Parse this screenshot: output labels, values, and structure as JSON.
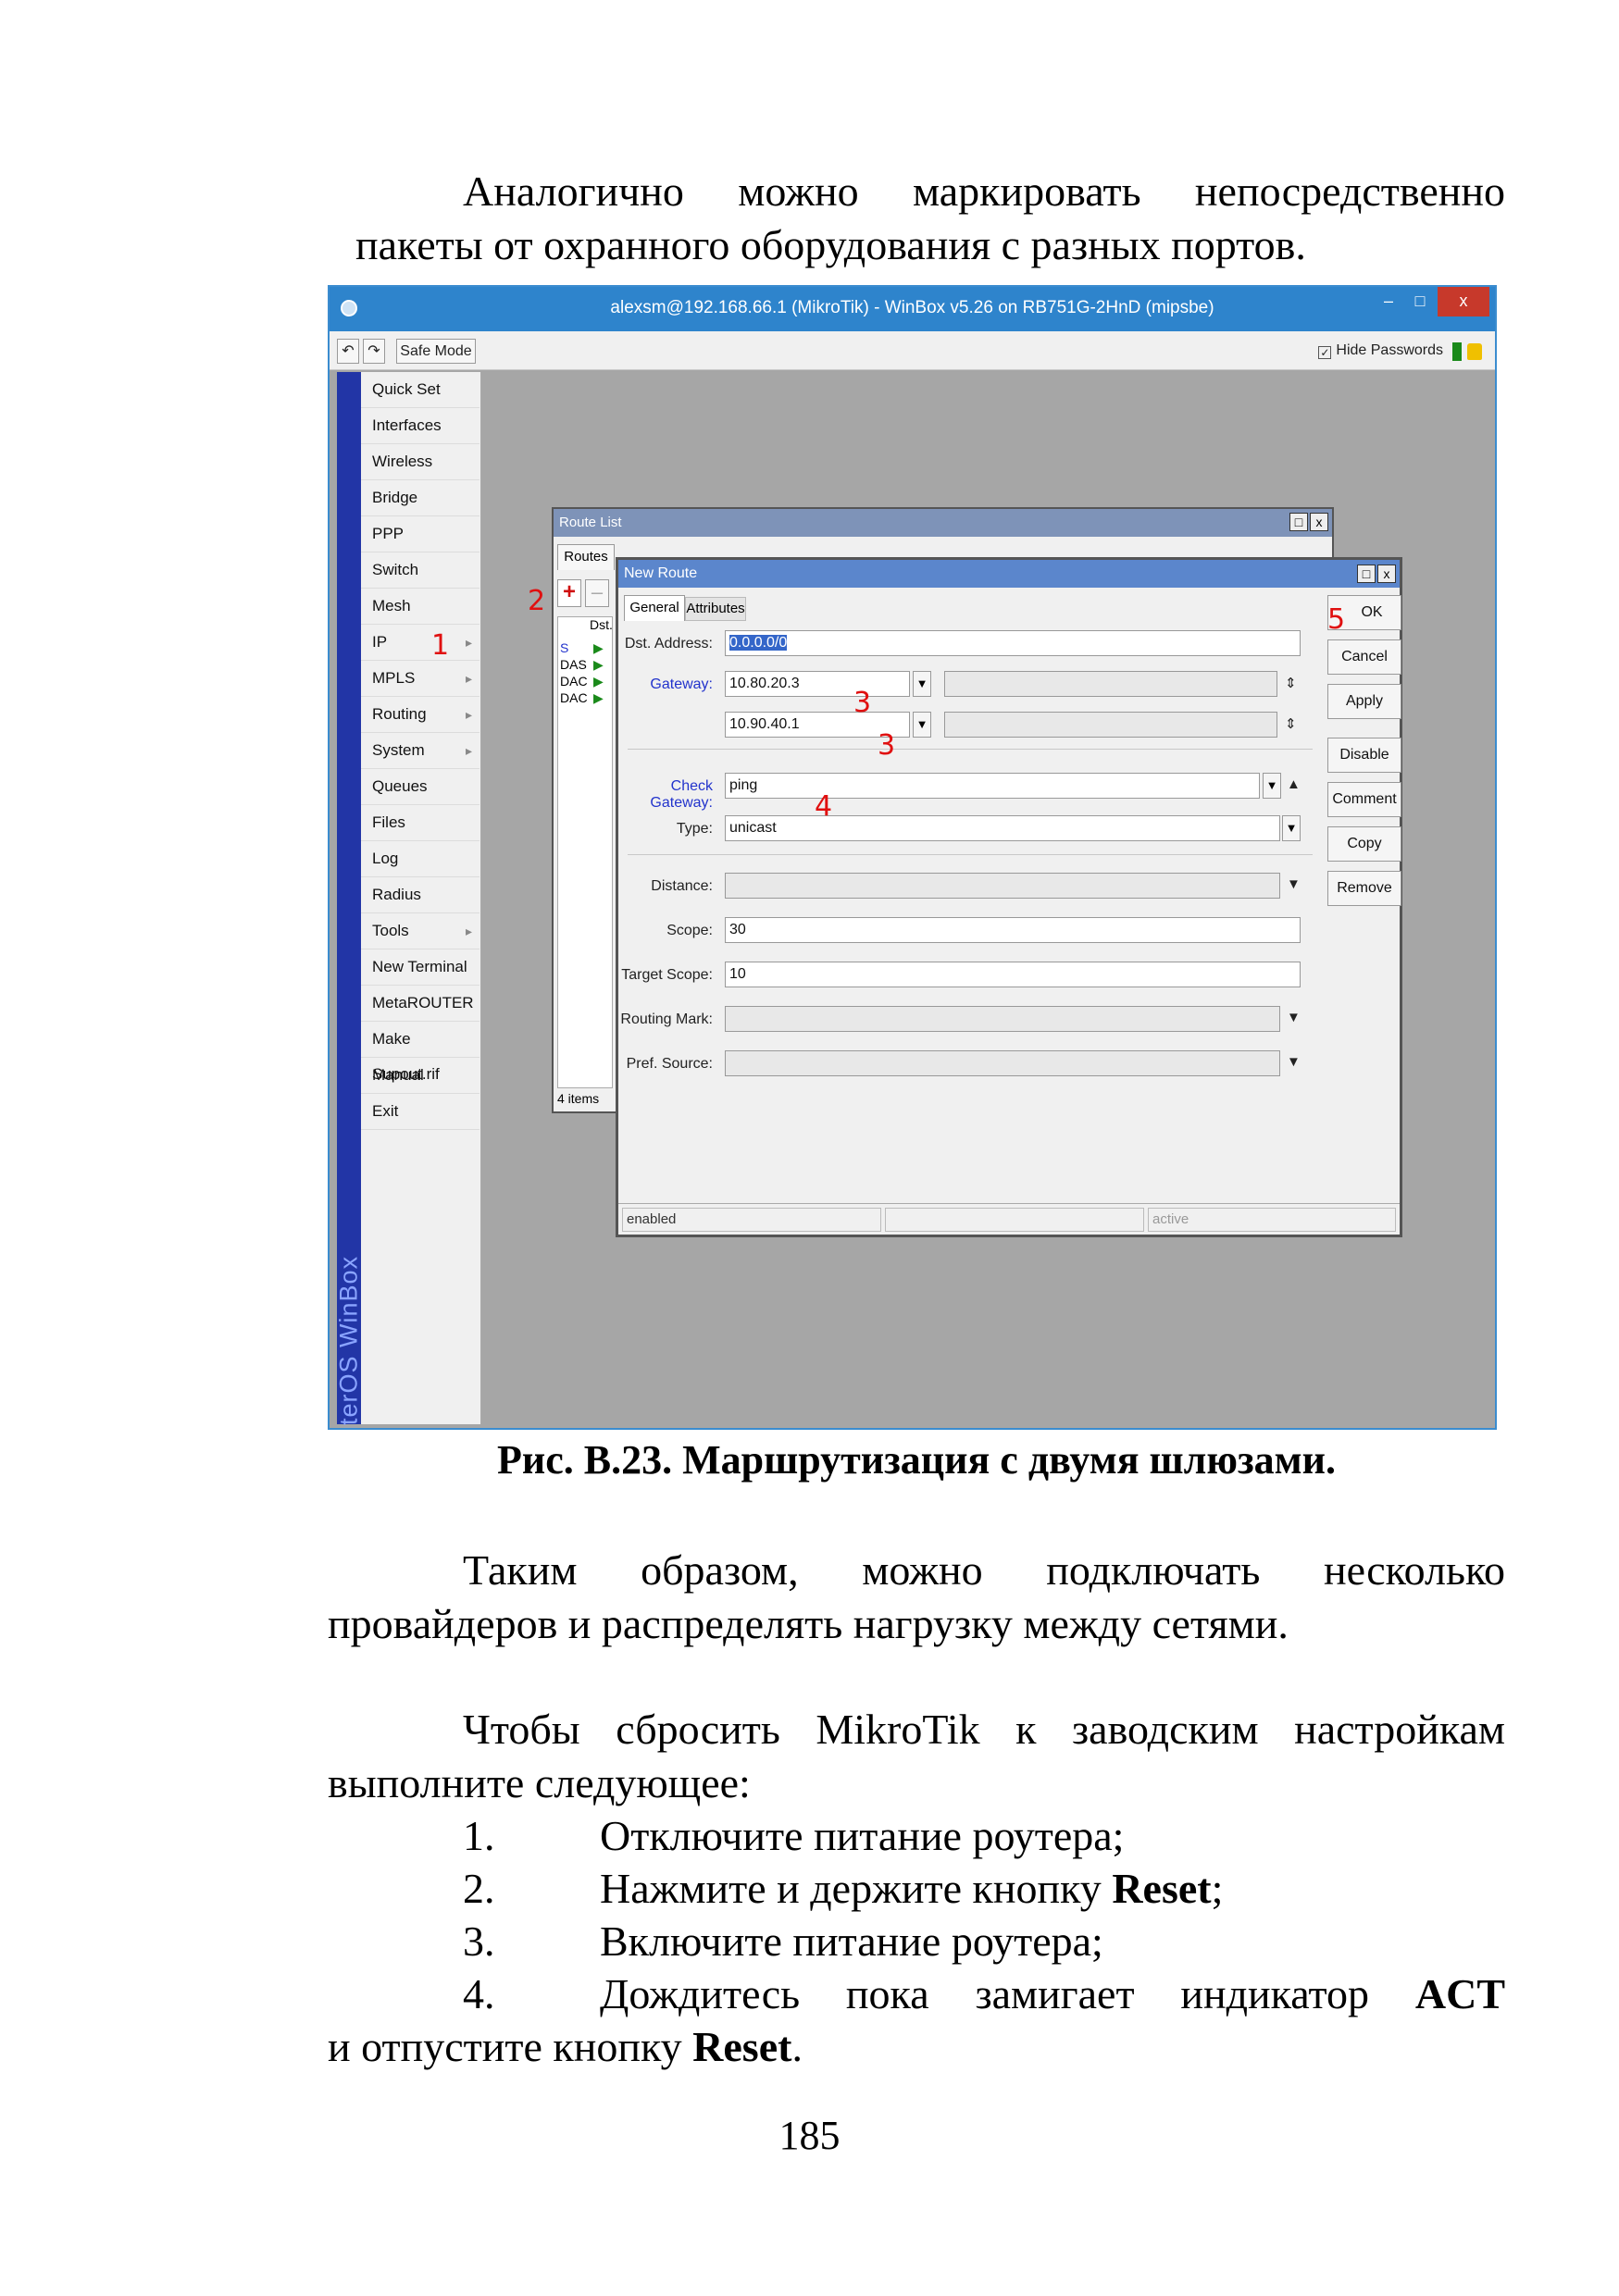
{
  "intro_line1": "Аналогично можно маркировать непосредственно",
  "intro_line2": "пакеты от охранного оборудования с разных портов.",
  "screenshot": {
    "title": "alexsm@192.168.66.1 (MikroTik) - WinBox v5.26 on RB751G-2HnD (mipsbe)",
    "window_buttons": {
      "minimize": "–",
      "maximize": "□",
      "close": "x"
    },
    "toolbar": {
      "undo": "↶",
      "redo": "↷",
      "safe_mode": "Safe Mode",
      "hide_passwords_check": "✓",
      "hide_passwords": "Hide Passwords"
    },
    "side_label": "RouterOS WinBox",
    "menu": [
      "Quick Set",
      "Interfaces",
      "Wireless",
      "Bridge",
      "PPP",
      "Switch",
      "Mesh",
      "IP",
      "MPLS",
      "Routing",
      "System",
      "Queues",
      "Files",
      "Log",
      "Radius",
      "Tools",
      "New Terminal",
      "MetaROUTER",
      "Make Supout.rif",
      "Manual",
      "Exit"
    ],
    "submenu_arrow": "▸",
    "route_list": {
      "title": "Route List",
      "tab": "Routes",
      "add": "+",
      "remove": "–",
      "col_dst": "Dst.",
      "rows": [
        {
          "flag": "S",
          "mark": "▶"
        },
        {
          "flag": "DAS",
          "mark": "▶"
        },
        {
          "flag": "DAC",
          "mark": "▶"
        },
        {
          "flag": "DAC",
          "mark": "▶"
        }
      ],
      "count": "4 items",
      "ctl_max": "□",
      "ctl_close": "x"
    },
    "new_route": {
      "title": "New Route",
      "ctl_max": "□",
      "ctl_close": "x",
      "tabs": [
        "General",
        "Attributes"
      ],
      "dst_label": "Dst. Address:",
      "dst_value": "0.0.0.0/0",
      "gateway_label": "Gateway:",
      "gateway1": "10.80.20.3",
      "gateway2": "10.90.40.1",
      "check_gateway_label": "Check Gateway:",
      "check_gateway": "ping",
      "type_label": "Type:",
      "type_value": "unicast",
      "distance_label": "Distance:",
      "scope_label": "Scope:",
      "scope_value": "30",
      "target_scope_label": "Target Scope:",
      "target_scope_value": "10",
      "routing_mark_label": "Routing Mark:",
      "pref_source_label": "Pref. Source:",
      "dd": "▼",
      "updown": "⇕",
      "up": "▲",
      "down": "▼",
      "buttons": [
        "OK",
        "Cancel",
        "Apply",
        "Disable",
        "Comment",
        "Copy",
        "Remove"
      ],
      "status_left": "enabled",
      "status_right": "active"
    },
    "annotations": {
      "n1": "1",
      "n2": "2",
      "n3a": "3",
      "n3b": "3",
      "n4": "4",
      "n5": "5"
    }
  },
  "caption": "Рис. В.23. Маршрутизация с двумя шлюзами.",
  "para2_line1": "Таким образом, можно подключать несколько",
  "para2_line2": "провайдеров и распределять нагрузку между сетями.",
  "para3_line1": "Чтобы сбросить MikroTik к заводским настройкам",
  "para3_line2": "выполните следующее:",
  "steps": [
    {
      "num": "1.",
      "text": "Отключите питание роутера;"
    },
    {
      "num": "2.",
      "pre": "Нажмите и держите кнопку ",
      "bold": "Reset",
      "post": ";"
    },
    {
      "num": "3.",
      "text": "Включите питание роутера;"
    },
    {
      "num": "4.",
      "pre": "Дождитесь пока замигает индикатор ",
      "bold": "ACT"
    }
  ],
  "step4_line2_pre": "и отпустите кнопку ",
  "step4_line2_bold": "Reset",
  "step4_line2_post": ".",
  "page_number": "185"
}
